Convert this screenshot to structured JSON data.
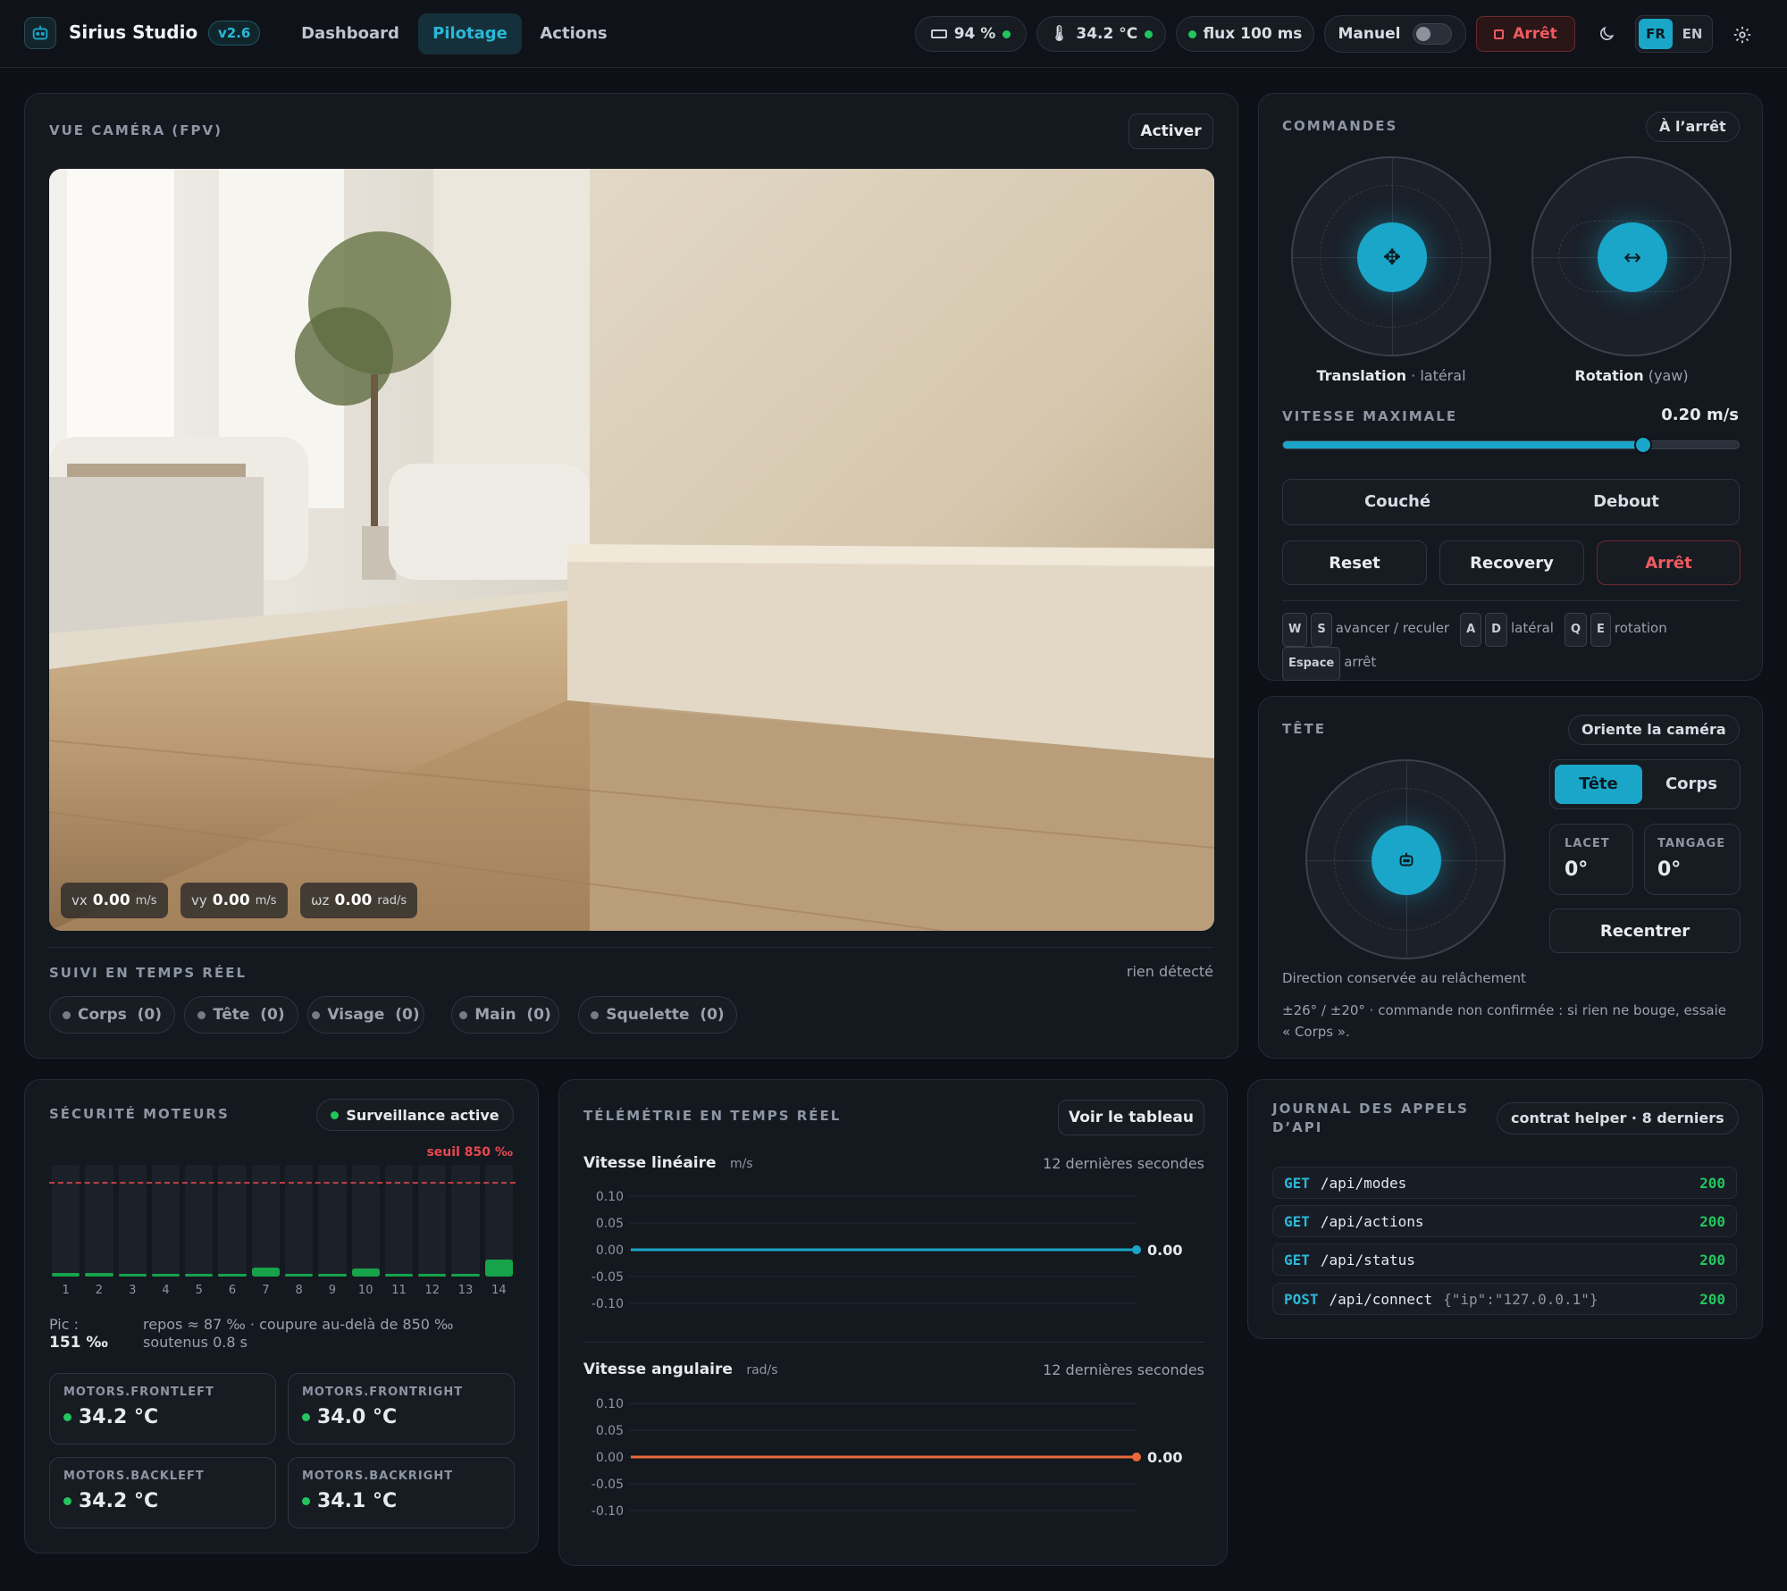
{
  "header": {
    "app_name": "Sirius Studio",
    "version": "v2.6",
    "nav": [
      "Dashboard",
      "Pilotage",
      "Actions"
    ],
    "active_nav": "Pilotage",
    "battery": "94 %",
    "temperature": "34.2 °C",
    "flux": "flux 100 ms",
    "mode_label": "Manuel",
    "stop_label": "Arrêt",
    "lang_fr": "FR",
    "lang_en": "EN"
  },
  "camera": {
    "title": "VUE CAMÉRA (FPV)",
    "activate": "Activer",
    "vx_label": "vx",
    "vx_value": "0.00",
    "vx_unit": "m/s",
    "vy_label": "vy",
    "vy_value": "0.00",
    "vy_unit": "m/s",
    "wz_label": "ωz",
    "wz_value": "0.00",
    "wz_unit": "rad/s"
  },
  "tracking": {
    "title": "SUIVI EN TEMPS RÉEL",
    "status": "rien détecté",
    "chips": [
      "Corps  (0)",
      "Tête  (0)",
      "Visage  (0)",
      "Main  (0)",
      "Squelette  (0)"
    ]
  },
  "commands": {
    "title": "COMMANDES",
    "state": "À l’arrêt",
    "translation_label": "Translation",
    "translation_sub": "· latéral",
    "rotation_label": "Rotation",
    "rotation_sub": "(yaw)",
    "speed_label": "VITESSE MAXIMALE",
    "speed_value": "0.20 m/s",
    "speed_fraction": 0.79,
    "posture": [
      "Couché",
      "Debout"
    ],
    "actions": [
      "Reset",
      "Recovery",
      "Arrêt"
    ],
    "keys": {
      "w": "W",
      "s": "S",
      "ws_desc": "avancer / reculer",
      "a": "A",
      "d": "D",
      "ad_desc": "latéral",
      "q": "Q",
      "e": "E",
      "qe_desc": "rotation",
      "space": "Espace",
      "space_desc": "arrêt"
    }
  },
  "head": {
    "title": "TÊTE",
    "badge": "Oriente la caméra",
    "toggle": [
      "Tête",
      "Corps"
    ],
    "yaw_label": "LACET",
    "yaw_value": "0°",
    "pitch_label": "TANGAGE",
    "pitch_value": "0°",
    "recenter": "Recentrer",
    "note1": "Direction conservée au relâchement",
    "note2": "±26° / ±20° · commande non confirmée : si rien ne bouge, essaie « Corps ».",
    "note2_a": "±26° / ±20° · commande non confirmée : si rien ne bouge, essaie",
    "note2_b": "« Corps »."
  },
  "motors": {
    "title": "SÉCURITÉ MOTEURS",
    "badge": "Surveillance active",
    "threshold_label": "seuil 850 ‰",
    "threshold": 850,
    "max": 1000,
    "values": [
      30,
      30,
      15,
      22,
      28,
      15,
      78,
      15,
      15,
      72,
      15,
      15,
      22,
      151
    ],
    "labels": [
      "1",
      "2",
      "3",
      "4",
      "5",
      "6",
      "7",
      "8",
      "9",
      "10",
      "11",
      "12",
      "13",
      "14"
    ],
    "peak_label": "Pic :",
    "peak_value": "151 ‰",
    "note": "repos ≈ 87 ‰ · coupure au-delà de 850 ‰ soutenus 0.8 s",
    "note_a": "repos ≈ 87 ‰ · coupure au-delà de 850 ‰",
    "note_b": "soutenus 0.8 s",
    "temps": [
      {
        "name": "MOTORS.FRONTLEFT",
        "value": "34.2 °C"
      },
      {
        "name": "MOTORS.FRONTRIGHT",
        "value": "34.0 °C"
      },
      {
        "name": "MOTORS.BACKLEFT",
        "value": "34.2 °C"
      },
      {
        "name": "MOTORS.BACKRIGHT",
        "value": "34.1 °C"
      }
    ]
  },
  "telemetry": {
    "title": "TÉLÉMÉTRIE EN TEMPS RÉEL",
    "button": "Voir le tableau",
    "linear_title": "Vitesse linéaire",
    "linear_unit": "m/s",
    "angular_title": "Vitesse angulaire",
    "angular_unit": "rad/s",
    "window": "12 dernières secondes",
    "ticks": [
      "0.10",
      "0.05",
      "0.00",
      "-0.05",
      "-0.10"
    ],
    "linear_value": "0.00",
    "angular_value": "0.00",
    "linear_color": "#1aa6c8",
    "angular_color": "#e8693a"
  },
  "chart_data": [
    {
      "type": "line",
      "title": "Vitesse linéaire",
      "ylabel": "m/s",
      "ylim": [
        -0.1,
        0.1
      ],
      "series": [
        {
          "values": [
            0.0,
            0.0
          ]
        }
      ]
    },
    {
      "type": "line",
      "title": "Vitesse angulaire",
      "ylabel": "rad/s",
      "ylim": [
        -0.1,
        0.1
      ],
      "series": [
        {
          "values": [
            0.0,
            0.0
          ]
        }
      ]
    }
  ],
  "api": {
    "title_a": "JOURNAL DES APPELS",
    "title_b": "D’API",
    "badge": "contrat helper · 8 derniers",
    "rows": [
      {
        "method": "GET",
        "path": "/api/modes",
        "body": "",
        "code": "200"
      },
      {
        "method": "GET",
        "path": "/api/actions",
        "body": "",
        "code": "200"
      },
      {
        "method": "GET",
        "path": "/api/status",
        "body": "",
        "code": "200"
      },
      {
        "method": "POST",
        "path": "/api/connect",
        "body": "{\"ip\":\"127.0.0.1\"}",
        "code": "200"
      }
    ]
  },
  "colors": {
    "accent": "#1aa6c8",
    "danger": "#e5484d",
    "ok": "#22c55e"
  }
}
